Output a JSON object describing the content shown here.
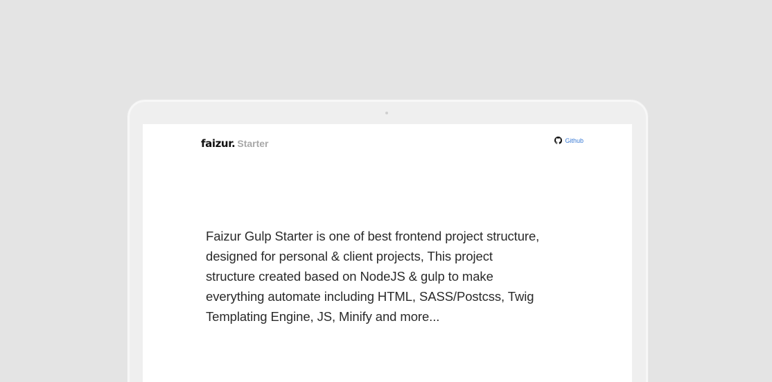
{
  "brand": {
    "name": "faizur.",
    "suffix": "Starter"
  },
  "nav": {
    "github_label": "Github",
    "github_icon": "github-icon",
    "link_color": "#3a7bd5"
  },
  "hero": {
    "description": "Faizur Gulp Starter is one of best frontend project structure, designed for personal & client projects, This project structure created based on NodeJS & gulp to make everything automate including HTML, SASS/Postcss, Twig Templating Engine, JS, Minify and more..."
  }
}
